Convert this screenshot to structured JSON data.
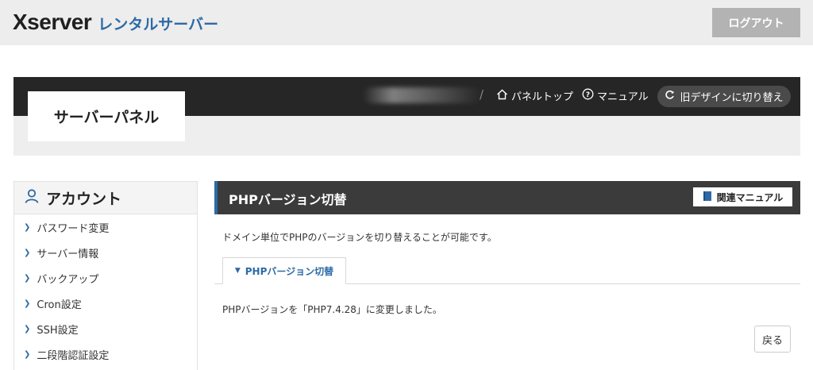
{
  "header": {
    "logo_main": "Xserver",
    "logo_sub": "レンタルサーバー",
    "logout_label": "ログアウト"
  },
  "panel": {
    "title": "サーバーパネル",
    "nav_separator": "/",
    "nav_top_label": "パネルトップ",
    "nav_manual_label": "マニュアル",
    "old_design_label": "旧デザインに切り替え"
  },
  "sidebar": {
    "heading": "アカウント",
    "items": [
      {
        "label": "パスワード変更"
      },
      {
        "label": "サーバー情報"
      },
      {
        "label": "バックアップ"
      },
      {
        "label": "Cron設定"
      },
      {
        "label": "SSH設定"
      },
      {
        "label": "二段階認証設定"
      }
    ]
  },
  "main": {
    "title": "PHPバージョン切替",
    "manual_label": "関連マニュアル",
    "description": "ドメイン単位でPHPのバージョンを切り替えることが可能です。",
    "tab_label": "PHPバージョン切替",
    "result_message": "PHPバージョンを「PHP7.4.28」に変更しました。",
    "back_label": "戻る"
  },
  "colors": {
    "accent": "#2d6aa5",
    "dark_bar": "#262626",
    "logout_bg": "#b3b3b3"
  },
  "icons": {
    "home": "home-icon",
    "help": "question-circle-icon",
    "refresh": "refresh-icon",
    "user": "user-icon",
    "book": "book-icon",
    "chevron": "chevron-right-icon"
  }
}
